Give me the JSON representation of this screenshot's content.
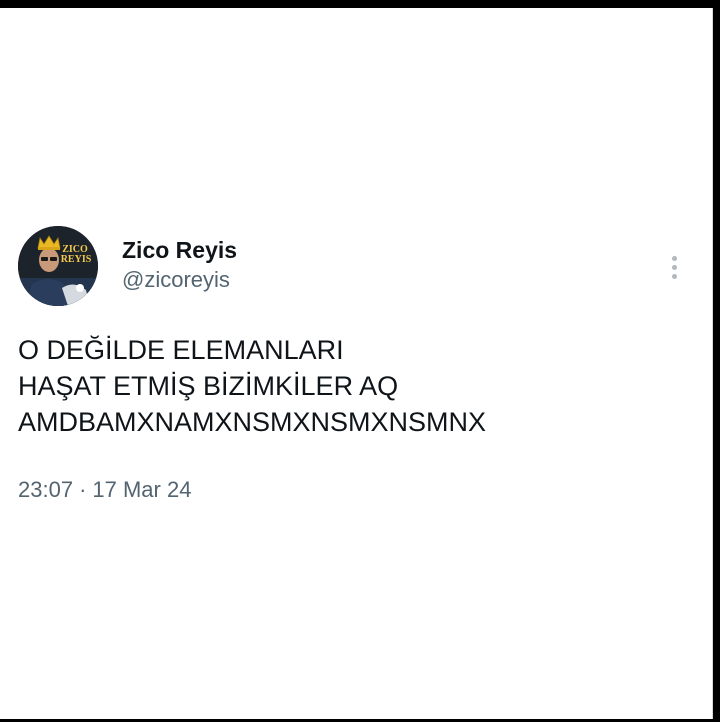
{
  "tweet": {
    "author": {
      "display_name": "Zico Reyis",
      "handle": "@zicoreyis",
      "avatar_text": [
        "ZICO",
        "REYIS"
      ]
    },
    "text_lines": [
      "O DEĞİLDE ELEMANLARI",
      "HAŞAT ETMİŞ BİZİMKİLER AQ",
      "AMDBAMXNAMXNSMXNSMXNSMNX"
    ],
    "time": "23:07",
    "separator": "·",
    "date": "17 Mar 24",
    "more_icon": "more-vertical-icon"
  },
  "colors": {
    "text_primary": "#0f1419",
    "text_secondary": "#536471",
    "background": "#ffffff"
  }
}
